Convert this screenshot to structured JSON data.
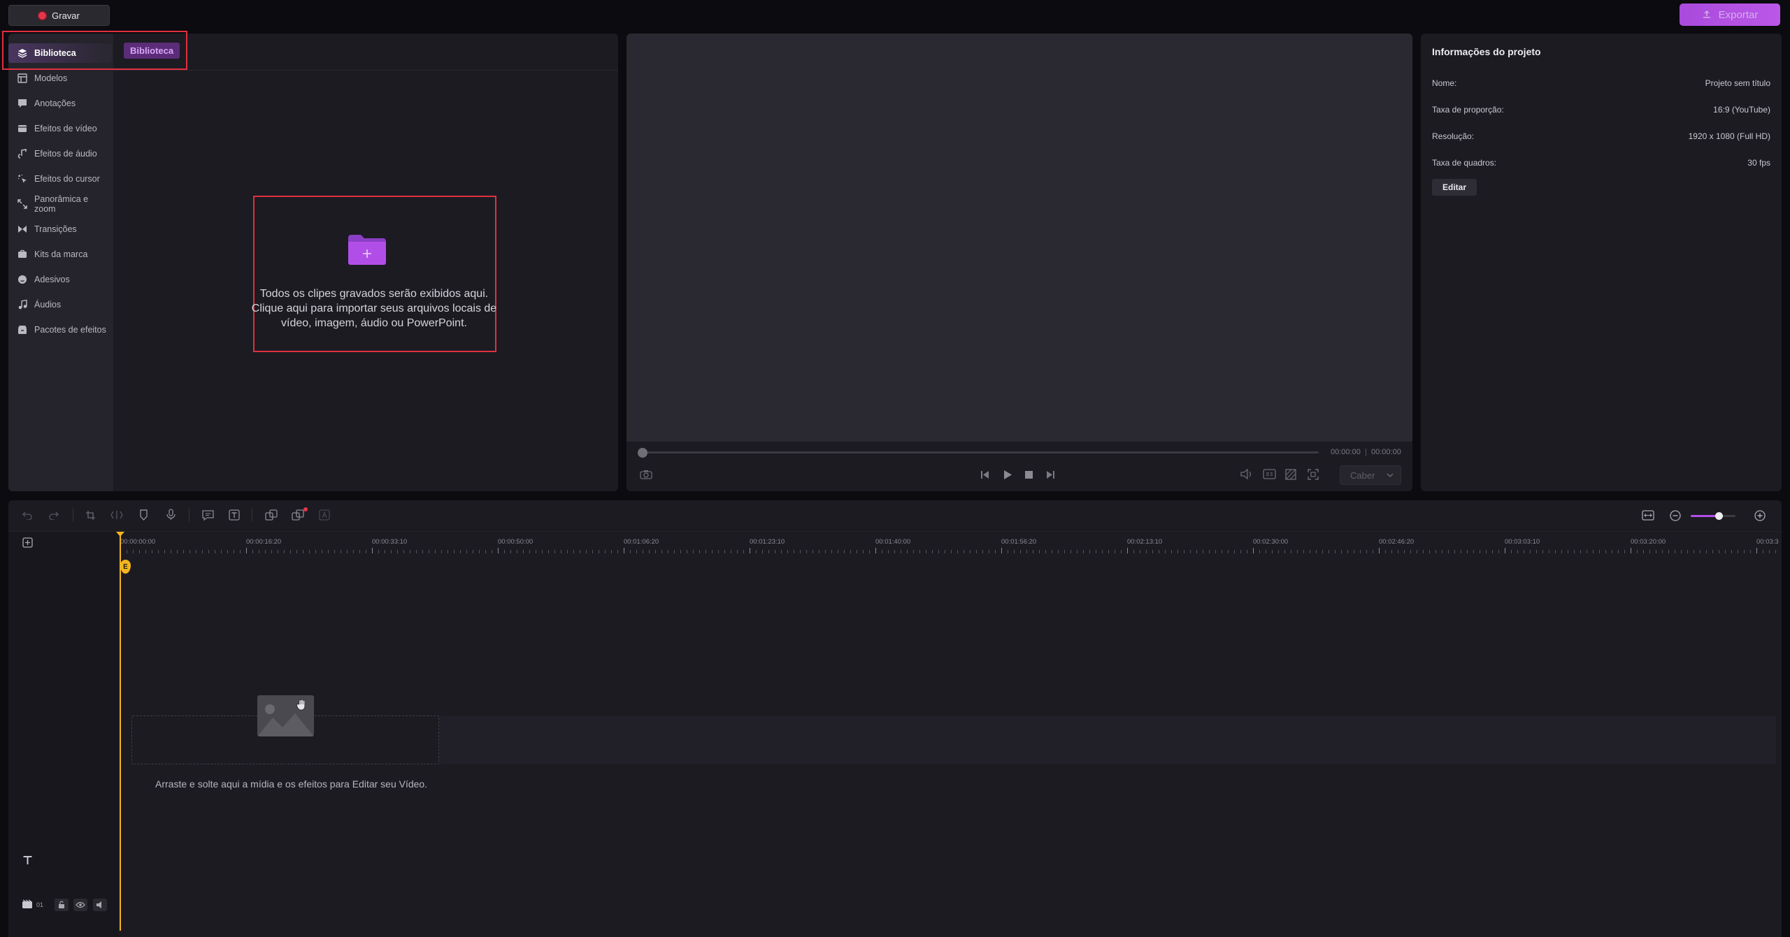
{
  "topbar": {
    "record_label": "Gravar",
    "export_label": "Exportar"
  },
  "library": {
    "tooltip": "Biblioteca",
    "items": [
      {
        "label": "Biblioteca",
        "icon": "layers-icon",
        "active": true
      },
      {
        "label": "Modelos",
        "icon": "templates-icon"
      },
      {
        "label": "Anotações",
        "icon": "annotation-icon"
      },
      {
        "label": "Efeitos de vídeo",
        "icon": "video-effects-icon"
      },
      {
        "label": "Efeitos de áudio",
        "icon": "audio-effects-icon"
      },
      {
        "label": "Efeitos do cursor",
        "icon": "cursor-effects-icon"
      },
      {
        "label": "Panorâmica e zoom",
        "icon": "pan-zoom-icon"
      },
      {
        "label": "Transições",
        "icon": "transitions-icon"
      },
      {
        "label": "Kits da marca",
        "icon": "brand-kit-icon"
      },
      {
        "label": "Adesivos",
        "icon": "sticker-icon"
      },
      {
        "label": "Áudios",
        "icon": "music-icon"
      },
      {
        "label": "Pacotes de efeitos",
        "icon": "effects-pack-icon"
      }
    ],
    "import_line1": "Todos os clipes gravados serão exibidos aqui.",
    "import_line2": "Clique aqui para importar seus arquivos locais de",
    "import_line3": "vídeo, imagem, áudio ou PowerPoint."
  },
  "preview": {
    "time_current": "00:00:00",
    "time_total": "00:00:00",
    "fit_option": "Caber"
  },
  "project_info": {
    "title": "Informações do projeto",
    "rows": [
      {
        "label": "Nome:",
        "value": "Projeto sem título"
      },
      {
        "label": "Taxa de proporção:",
        "value": "16:9 (YouTube)"
      },
      {
        "label": "Resolução:",
        "value": "1920 x 1080 (Full HD)"
      },
      {
        "label": "Taxa de quadros:",
        "value": "30 fps"
      }
    ],
    "edit_label": "Editar"
  },
  "timeline": {
    "ruler_labels": [
      "00:00:00:00",
      "00:00:16:20",
      "00:00:33:10",
      "00:00:50:00",
      "00:01:06:20",
      "00:01:23:10",
      "00:01:40:00",
      "00:01:56:20",
      "00:02:13:10",
      "00:02:30:00",
      "00:02:46:20",
      "00:03:03:10",
      "00:03:20:00",
      "00:03:3"
    ],
    "playhead_label": "E",
    "drop_text": "Arraste e solte aqui a mídia e os efeitos para Editar seu Vídeo.",
    "track_number": "01"
  },
  "colors": {
    "accent": "#b24ee8",
    "record": "#e8344a",
    "playhead": "#f2b51d",
    "highlight_box": "#e0303f"
  }
}
